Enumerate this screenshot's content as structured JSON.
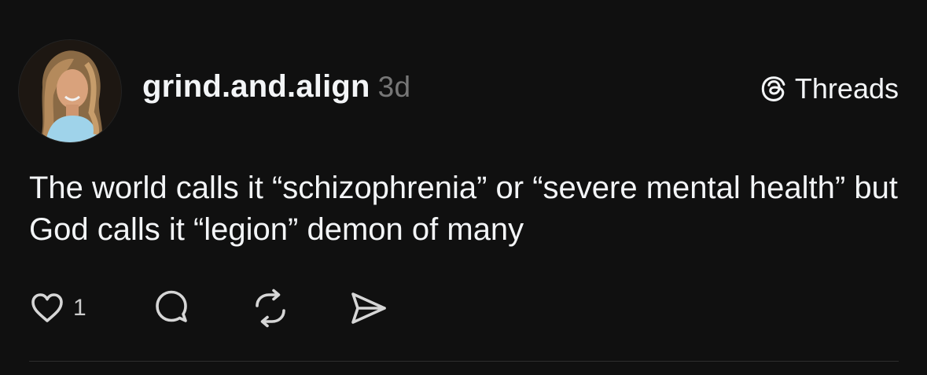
{
  "post": {
    "username": "grind.and.align",
    "timestamp": "3d",
    "text": "The world calls it “schizophrenia” or “severe mental health” but God calls it “legion” demon of many",
    "like_count": "1"
  },
  "brand": {
    "name": "Threads",
    "icon": "threads-logo-icon"
  },
  "actions": {
    "icons": [
      "heart-icon",
      "comment-icon",
      "repost-icon",
      "share-icon"
    ]
  },
  "colors": {
    "background": "#101010",
    "text": "#f3f5f7",
    "secondary_text": "#777777",
    "divider": "#2d2d2d"
  }
}
